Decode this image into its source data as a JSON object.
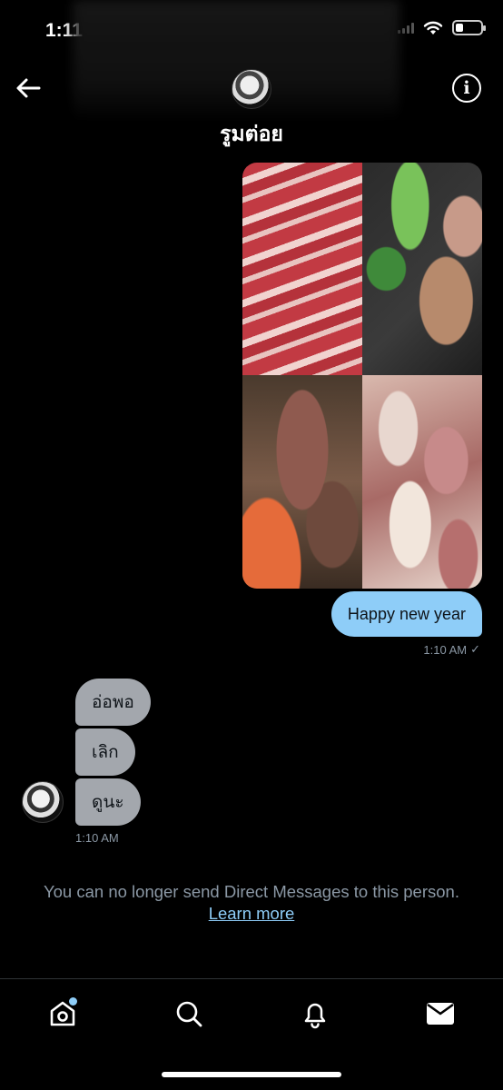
{
  "status_bar": {
    "time": "1:11"
  },
  "header": {
    "name": "รูมต่อย",
    "back_icon": "arrow-left-icon",
    "info_icon": "info-icon"
  },
  "photo_message": {
    "photos": [
      "meat-photo-1",
      "meat-photo-2",
      "meat-photo-3",
      "meat-photo-4"
    ]
  },
  "sent_message": {
    "text": "Happy new year",
    "time": "1:10 AM",
    "status": "✓"
  },
  "received_messages": {
    "items": [
      {
        "text": "อ่อพอ"
      },
      {
        "text": "เลิก"
      },
      {
        "text": "ดูนะ"
      }
    ],
    "time": "1:10 AM"
  },
  "notice": {
    "text": "You can no longer send Direct Messages to this person.",
    "link": "Learn more"
  },
  "bottom_nav": {
    "items": [
      "home-icon",
      "search-icon",
      "bell-icon",
      "mail-icon"
    ],
    "accent": "#8ecdf8"
  }
}
